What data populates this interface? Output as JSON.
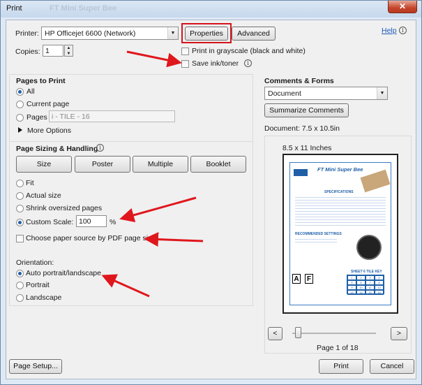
{
  "window": {
    "title": "Print",
    "ghost_title": "FT Mini Super Bee",
    "close_label": "✕"
  },
  "printer": {
    "label": "Printer:",
    "selected": "HP Officejet 6600 (Network)",
    "properties_label": "Properties",
    "advanced_label": "Advanced",
    "help_label": "Help",
    "copies_label": "Copies:",
    "copies_value": "1",
    "grayscale_label": "Print in grayscale (black and white)",
    "save_ink_label": "Save ink/toner"
  },
  "pages_to_print": {
    "title": "Pages to Print",
    "all_label": "All",
    "current_label": "Current page",
    "pages_label": "Pages",
    "pages_value": "i - TILE - 16",
    "more_options_label": "More Options"
  },
  "sizing": {
    "title": "Page Sizing & Handling",
    "tabs": [
      "Size",
      "Poster",
      "Multiple",
      "Booklet"
    ],
    "fit_label": "Fit",
    "actual_label": "Actual size",
    "shrink_label": "Shrink oversized pages",
    "custom_label": "Custom Scale:",
    "custom_value": "100",
    "percent": "%",
    "paper_source_label": "Choose paper source by PDF page size"
  },
  "orientation": {
    "title": "Orientation:",
    "auto_label": "Auto portrait/landscape",
    "portrait_label": "Portrait",
    "landscape_label": "Landscape"
  },
  "comments": {
    "title": "Comments & Forms",
    "selected": "Document",
    "summarize_label": "Summarize Comments",
    "document_size": "Document: 7.5 x 10.5in",
    "paper_size": "8.5 x 11 Inches"
  },
  "preview_page": {
    "heading": "FT Mini Super Bee",
    "specs_title": "SPECIFICATIONS",
    "recommended_title": "RECOMMENDED SETTINGS",
    "sheet_title": "SHEET 6 TILE KEY",
    "tile_numbers": [
      "1",
      "2",
      "3",
      "4",
      "5",
      "6",
      "7",
      "8",
      "9",
      "10",
      "11",
      "12",
      "13",
      "14",
      "15",
      "16"
    ]
  },
  "pager": {
    "prev": "<",
    "next": ">",
    "status": "Page 1 of 18"
  },
  "footer": {
    "page_setup_label": "Page Setup...",
    "print_label": "Print",
    "cancel_label": "Cancel"
  },
  "colors": {
    "annotation_red": "#e0161d",
    "accent_blue": "#1f5fa8"
  }
}
